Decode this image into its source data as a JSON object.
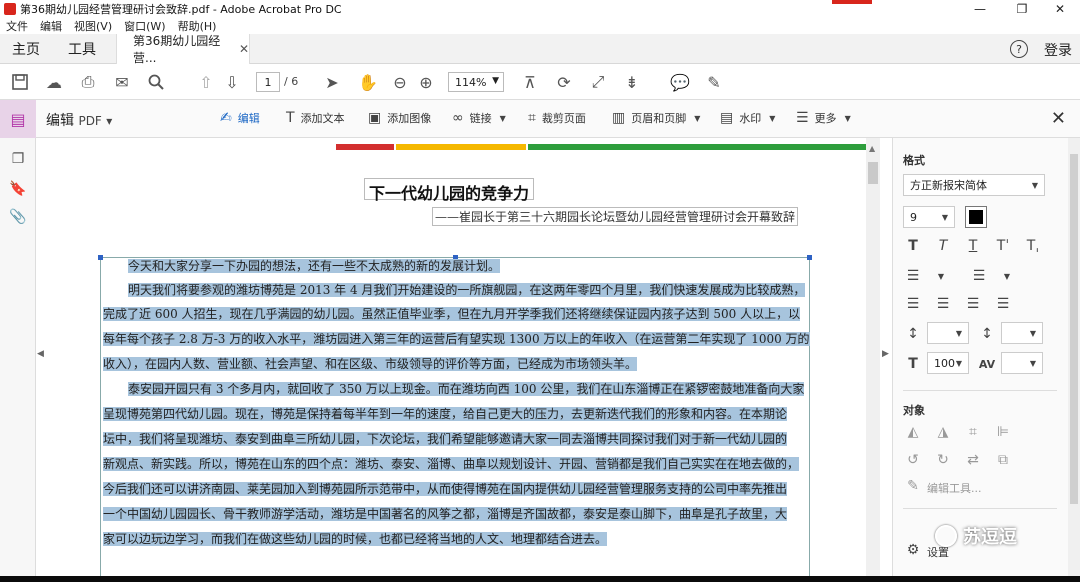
{
  "window": {
    "title": "第36期幼儿园经营管理研讨会致辞.pdf - Adobe Acrobat Pro DC"
  },
  "menu": [
    "文件",
    "编辑",
    "视图(V)",
    "窗口(W)",
    "帮助(H)"
  ],
  "tabs": {
    "home": "主页",
    "tools": "工具",
    "document": "第36期幼儿园经营...",
    "login": "登录"
  },
  "toolbar": {
    "page_current": "1",
    "page_total": "/ 6",
    "zoom": "114%"
  },
  "edit_toolbar": {
    "mode": "编辑",
    "mode_suffix": "PDF",
    "items": [
      "编辑",
      "添加文本",
      "添加图像",
      "链接",
      "裁剪页面",
      "页眉和页脚",
      "水印",
      "更多"
    ]
  },
  "document": {
    "title": "下一代幼儿园的竞争力",
    "subtitle": "——崔园长于第三十六期园长论坛暨幼儿园经营管理研讨会开幕致辞",
    "lines": [
      "今天和大家分享一下办园的想法，还有一些不太成熟的新的发展计划。",
      "明天我们将要参观的潍坊博苑是 2013 年 4 月我们开始建设的一所旗舰园，在这两年零四个月里，我们快速发展成为比较成熟，",
      "完成了近 600 人招生，现在几乎满园的幼儿园。虽然正值毕业季，但在九月开学季我们还将继续保证园内孩子达到 500 人以上，以",
      "每年每个孩子 2.8 万-3 万的收入水平，潍坊园进入第三年的运营后有望实现 1300 万以上的年收入（在运营第二年实现了 1000 万的",
      "收入），在园内人数、营业额、社会声望、和在区级、市级领导的评价等方面，已经成为市场领头羊。",
      "泰安园开园只有 3 个多月内，就回收了 350 万以上现金。而在潍坊向西 100 公里，我们在山东淄博正在紧锣密鼓地准备向大家",
      "呈现博苑第四代幼儿园。现在，博苑是保持着每半年到一年的速度，给自己更大的压力，去更新迭代我们的形象和内容。在本期论",
      "坛中，我们将呈现潍坊、泰安到曲阜三所幼儿园，下次论坛，我们希望能够邀请大家一同去淄博共同探讨我们对于新一代幼儿园的",
      "新观点、新实践。所以，博苑在山东的四个点：潍坊、泰安、淄博、曲阜以规划设计、开园、营销都是我们自己实实在在地去做的，",
      "今后我们还可以讲济南园、莱芜园加入到博苑园所示范带中，从而使得博苑在国内提供幼儿园经营管理服务支持的公司中率先推出",
      "一个中国幼儿园园长、骨干教师游学活动，潍坊是中国著名的风筝之都，淄博是齐国故都，泰安是泰山脚下，曲阜是孔子故里，大",
      "家可以边玩边学习，而我们在做这些幼儿园的时候，也都已经将当地的人文、地理都结合进去。"
    ]
  },
  "right_panel": {
    "format_heading": "格式",
    "font": "方正新报宋简体",
    "font_size": "9",
    "scale": "100",
    "object_heading": "对象",
    "edit_tools": "编辑工具...",
    "settings": "设置",
    "text_color": "#000000"
  },
  "watermark": "苏逗逗",
  "colors": {
    "accent_purple": "#b236a8",
    "selection": "#a7c4dd",
    "bar_red": "#d32f2f",
    "bar_yellow": "#f5b800",
    "bar_green": "#2e9e3c"
  }
}
